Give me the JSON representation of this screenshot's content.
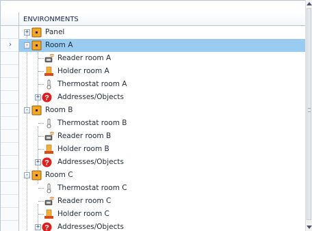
{
  "header": {
    "title": "ENVIRONMENTS"
  },
  "tree": {
    "nodes": [
      {
        "label": "Panel",
        "icon": "panel-icon",
        "expander": "+"
      },
      {
        "label": "Room A",
        "icon": "room-icon",
        "expander": "-",
        "selected": true
      },
      {
        "label": "Reader room A",
        "icon": "reader-icon"
      },
      {
        "label": "Holder room A",
        "icon": "holder-icon"
      },
      {
        "label": "Thermostat room A",
        "icon": "thermostat-icon"
      },
      {
        "label": "Addresses/Objects",
        "icon": "question-icon",
        "expander": "+"
      },
      {
        "label": "Room B",
        "icon": "room-icon",
        "expander": "-"
      },
      {
        "label": "Thermostat room B",
        "icon": "thermostat-icon"
      },
      {
        "label": "Reader room B",
        "icon": "reader-icon"
      },
      {
        "label": "Holder room B",
        "icon": "holder-icon"
      },
      {
        "label": "Addresses/Objects",
        "icon": "question-icon",
        "expander": "+"
      },
      {
        "label": "Room C",
        "icon": "room-icon",
        "expander": "-"
      },
      {
        "label": "Thermostat room C",
        "icon": "thermostat-icon"
      },
      {
        "label": "Reader room C",
        "icon": "reader-icon"
      },
      {
        "label": "Holder room C",
        "icon": "holder-icon"
      },
      {
        "label": "Addresses/Objects",
        "icon": "question-icon",
        "expander": "+"
      }
    ]
  },
  "row_pointer": "›",
  "colors": {
    "selection": "#99ccf0",
    "grid_border": "#b8c4d4",
    "room_icon_fill": "#f5a623",
    "question_icon_fill": "#e01e1e"
  }
}
